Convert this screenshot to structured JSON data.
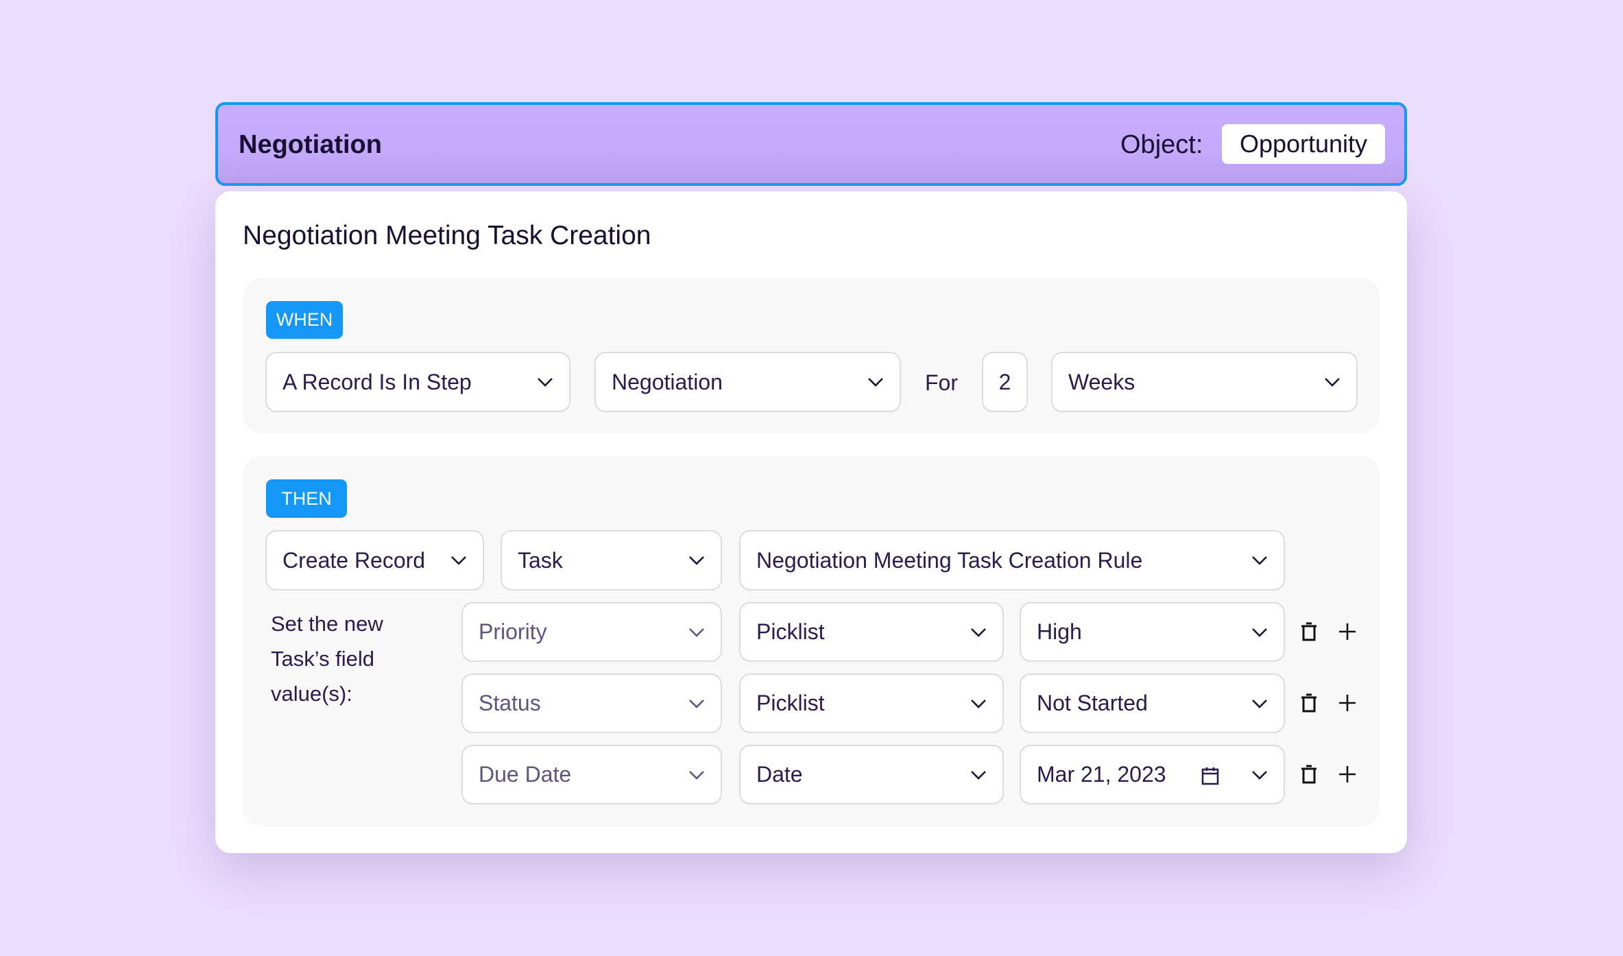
{
  "header": {
    "stage_title": "Negotiation",
    "object_label": "Object:",
    "object_value": "Opportunity",
    "border_color": "#1597F7"
  },
  "card": {
    "title": "Negotiation Meeting Task Creation"
  },
  "when": {
    "badge": "WHEN",
    "trigger_select": {
      "value": "A Record Is In Step",
      "icon": "chevron-down-icon"
    },
    "step_select": {
      "value": "Negotiation",
      "icon": "chevron-down-icon"
    },
    "for_label": "For",
    "duration_value": "2",
    "unit_select": {
      "value": "Weeks",
      "icon": "chevron-down-icon"
    }
  },
  "then": {
    "badge": "THEN",
    "action_select": {
      "value": "Create Record",
      "icon": "chevron-down-icon"
    },
    "object_select": {
      "value": "Task",
      "icon": "chevron-down-icon"
    },
    "rule_select": {
      "value": "Negotiation Meeting Task Creation Rule",
      "icon": "chevron-down-icon"
    },
    "field_values_label": [
      "Set the new",
      "Task’s field",
      "value(s):"
    ],
    "field_rows": [
      {
        "field": "Priority",
        "type": "Picklist",
        "value": "High",
        "value_icon": null
      },
      {
        "field": "Status",
        "type": "Picklist",
        "value": "Not Started",
        "value_icon": null
      },
      {
        "field": "Due Date",
        "type": "Date",
        "value": "Mar 21, 2023",
        "value_icon": "calendar-icon"
      }
    ],
    "row_actions": {
      "delete_icon": "trash-icon",
      "add_icon": "plus-icon"
    }
  },
  "colors": {
    "background": "#EBDDFD",
    "header_bg": "#C5ABFC",
    "accent_blue": "#1597F7",
    "panel_bg": "#F8F8F8",
    "text_dark": "#22173F",
    "text_muted": "#5F5480"
  }
}
